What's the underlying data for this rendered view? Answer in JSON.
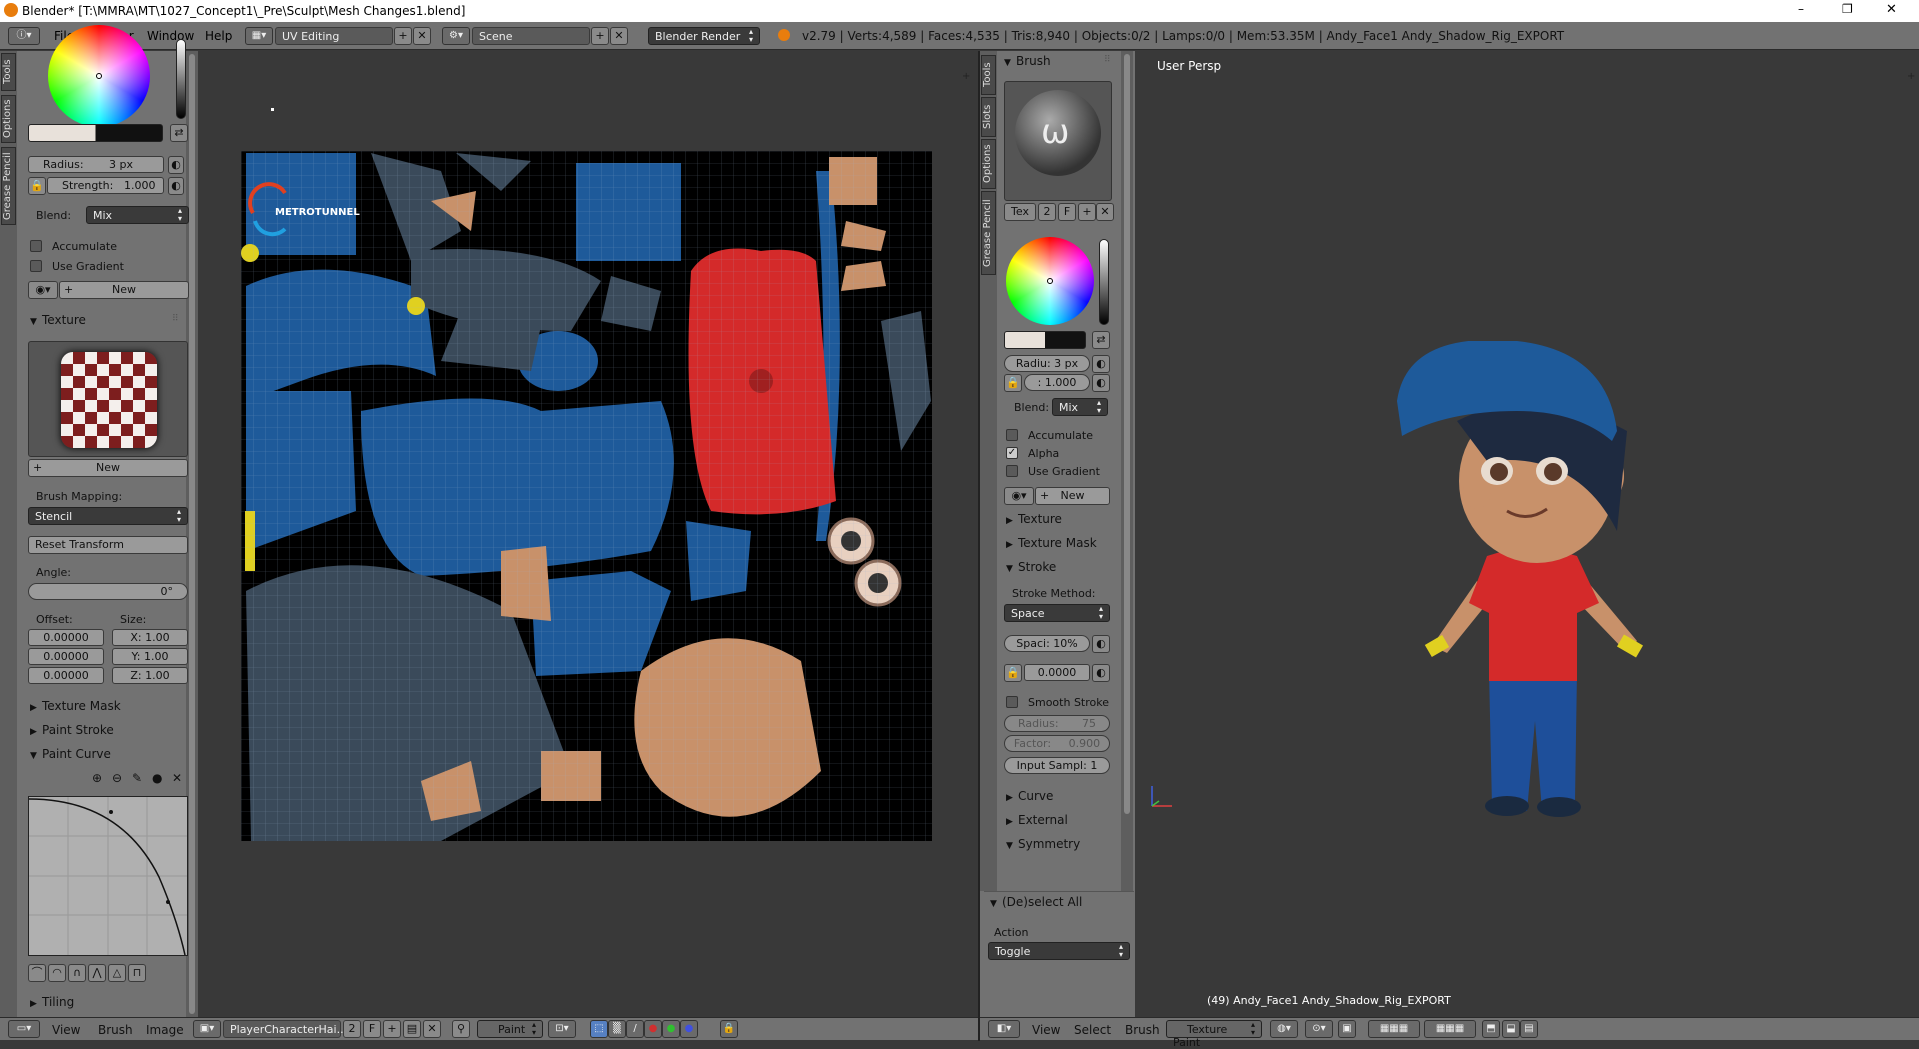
{
  "window": {
    "title": "Blender* [T:\\MMRA\\MT\\1027_Concept1\\_Pre\\Sculpt\\Mesh Changes1.blend]",
    "controls": [
      "–",
      "❐",
      "✕"
    ]
  },
  "topbar": {
    "menus": [
      "File",
      "Render",
      "Window",
      "Help"
    ],
    "layout": "UV Editing",
    "scene": "Scene",
    "engine": "Blender Render",
    "stats": "v2.79 | Verts:4,589 | Faces:4,535 | Tris:8,940 | Objects:0/2 | Lamps:0/0 | Mem:53.35M | Andy_Face1 Andy_Shadow_Rig_EXPORT"
  },
  "left_panel": {
    "tabs": [
      "Tools",
      "Options",
      "Grease Pencil"
    ],
    "radius": "Radius:",
    "radius_val": "3 px",
    "strength": "Strength:",
    "strength_val": "1.000",
    "blend_label": "Blend:",
    "blend": "Mix",
    "accumulate": "Accumulate",
    "use_gradient": "Use Gradient",
    "new": "New",
    "texture_hdr": "Texture",
    "tex_new": "New",
    "brush_mapping": "Brush Mapping:",
    "stencil": "Stencil",
    "reset_transform": "Reset Transform",
    "angle_label": "Angle:",
    "angle": "0°",
    "offset_label": "Offset:",
    "size_label": "Size:",
    "offsets": [
      "0.00000",
      "0.00000",
      "0.00000"
    ],
    "sizes": [
      {
        "axis": "X:",
        "val": "1.00"
      },
      {
        "axis": "Y:",
        "val": "1.00"
      },
      {
        "axis": "Z:",
        "val": "1.00"
      }
    ],
    "texture_mask": "Texture Mask",
    "paint_stroke": "Paint Stroke",
    "paint_curve": "Paint Curve",
    "tiling": "Tiling"
  },
  "uv_editor": {
    "logo": "METROTUNNEL",
    "bottom": {
      "menus": [
        "View",
        "Brush",
        "Image"
      ],
      "image": "PlayerCharacterHai...",
      "users": "2",
      "f": "F",
      "mode": "Paint"
    }
  },
  "right_panel": {
    "tabs": [
      "Tools",
      "Slots",
      "Options",
      "Grease Pencil"
    ],
    "brush_hdr": "Brush",
    "tex": "Tex",
    "tex_users": "2",
    "tex_f": "F",
    "radius": "Radiu: 3 px",
    "strength": ": 1.000",
    "blend_label": "Blend:",
    "blend": "Mix",
    "accumulate": "Accumulate",
    "alpha": "Alpha",
    "use_gradient": "Use Gradient",
    "new": "New",
    "texture": "Texture",
    "texture_mask": "Texture Mask",
    "stroke": "Stroke",
    "stroke_method": "Stroke Method:",
    "space": "Space",
    "spacing": "Spaci: 10%",
    "jitter": "0.0000",
    "smooth_stroke": "Smooth Stroke",
    "smooth_radius": "Radius:",
    "smooth_radius_val": "75",
    "factor": "Factor:",
    "factor_val": "0.900",
    "input_samples": "Input Sampl: 1",
    "curve": "Curve",
    "external": "External",
    "symmetry": "Symmetry",
    "deselect_all": "(De)select All",
    "action": "Action",
    "toggle": "Toggle"
  },
  "viewport": {
    "label": "User Persp",
    "object": "(49) Andy_Face1 Andy_Shadow_Rig_EXPORT",
    "bottom": {
      "menus": [
        "View",
        "Select",
        "Brush"
      ],
      "mode": "Texture Paint"
    }
  },
  "colors": {
    "ui_grey": "#727272",
    "editor_bg": "#393939",
    "cap_blue": "#1e5a9a",
    "shirt_red": "#d42a2a",
    "skin": "#c8916a",
    "pants_blue": "#1e4f9a",
    "wristband": "#e0d020"
  }
}
